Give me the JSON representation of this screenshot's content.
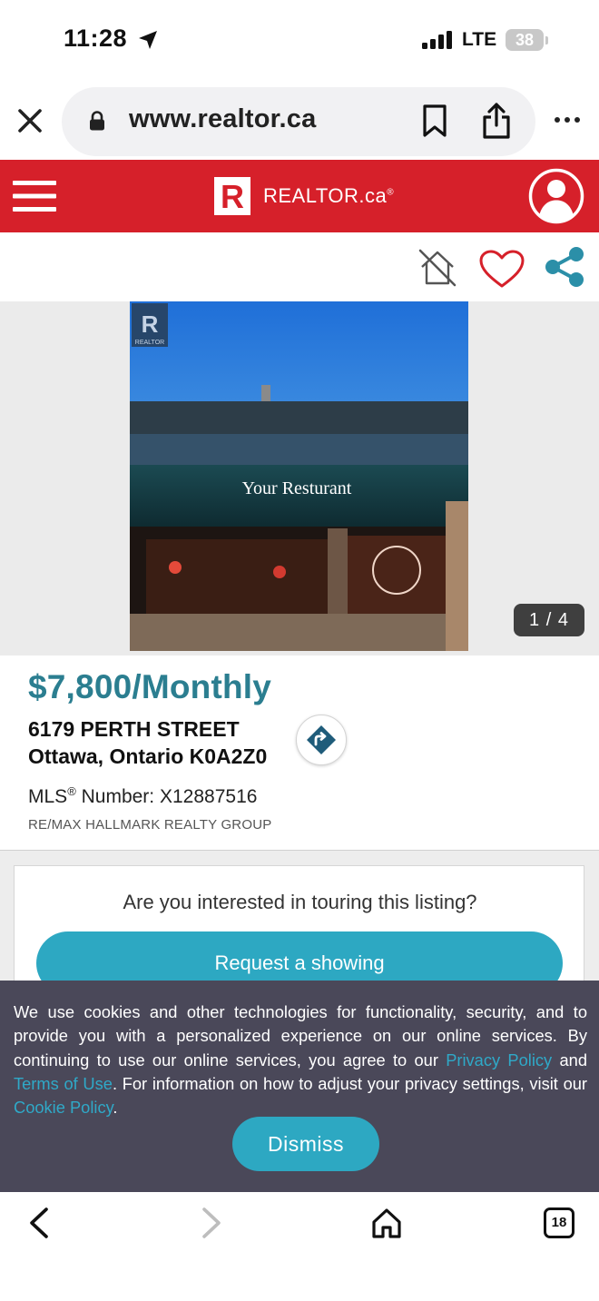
{
  "status_bar": {
    "time": "11:28",
    "network": "LTE",
    "battery": "38"
  },
  "browser": {
    "url": "www.realtor.ca",
    "tab_count": "18"
  },
  "site": {
    "logo_letter": "R",
    "logo_text": "REALTOR.ca",
    "logo_mark": "®",
    "brand_color": "#d6202a",
    "accent_color": "#2da8c2"
  },
  "photo": {
    "watermark_letter": "R",
    "watermark_text": "REALTOR",
    "sign_text": "Your Resturant",
    "counter": "1 / 4"
  },
  "listing": {
    "price": "$7,800/Monthly",
    "address_line1": "6179 PERTH STREET",
    "address_line2": "Ottawa, Ontario K0A2Z0",
    "mls_prefix": "MLS",
    "mls_mark": "®",
    "mls_label": " Number: ",
    "mls_number": "X12887516",
    "brokerage": "RE/MAX HALLMARK REALTY GROUP"
  },
  "tour": {
    "question": "Are you interested in touring this listing?",
    "request_label": "Request a showing"
  },
  "cookie_banner": {
    "text_1": "We use cookies and other technologies for functionality, security, and to provide you with a personalized experience on our online services. By continuing to use our online services, you agree to our ",
    "privacy_link": "Privacy Policy",
    "text_2": " and ",
    "terms_link": "Terms of Use",
    "text_3": ". For information on how to adjust your privacy settings, visit our ",
    "cookie_link": "Cookie Policy",
    "text_4": ".",
    "dismiss_label": "Dismiss"
  },
  "icons": {
    "status": [
      "location-arrow-icon",
      "signal-icon",
      "battery-icon"
    ],
    "browser": [
      "close-icon",
      "lock-icon",
      "bookmark-icon",
      "share-icon",
      "more-icon",
      "back-icon",
      "forward-icon",
      "home-icon",
      "tabs-icon"
    ],
    "site": [
      "menu-icon",
      "account-icon",
      "hide-listing-icon",
      "favorite-heart-icon",
      "share-nodes-icon",
      "directions-icon"
    ]
  }
}
